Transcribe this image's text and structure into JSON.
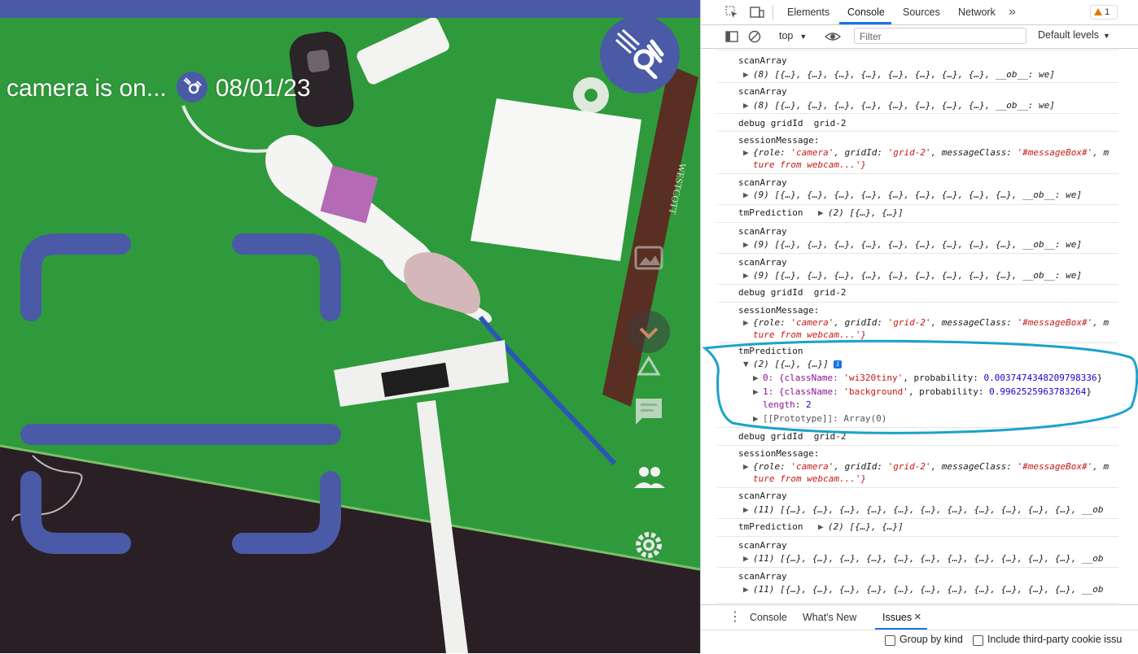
{
  "camera_app": {
    "status_text": "camera is on...",
    "date": "08/01/23",
    "ruler_brand": "WESTCOTT",
    "tag_qr": "Ⓠ"
  },
  "devtools": {
    "tabs": [
      "Elements",
      "Console",
      "Sources",
      "Network"
    ],
    "more_tabs": "»",
    "issues_count": "1",
    "context": "top",
    "filter_placeholder": "Filter",
    "levels": "Default levels",
    "drawer_tabs": {
      "console": "Console",
      "whats_new": "What's New",
      "issues": "Issues"
    },
    "checkbox_group_by_kind": "Group by kind",
    "checkbox_third_party": "Include third-party cookie issu",
    "close": "×"
  },
  "console": {
    "scan8_label": "scanArray",
    "scan8_value": "(8) [{…}, {…}, {…}, {…}, {…}, {…}, {…}, {…}, __ob__: we]",
    "debug_label": "debug gridId",
    "debug_value": "grid-2",
    "session_label": "sessionMessage:",
    "session_line1_a": "{role: ",
    "session_role": "'camera'",
    "session_line1_b": ", gridId: ",
    "session_grid": "'grid-2'",
    "session_line1_c": ", messageClass: ",
    "session_msgclass": "'#messageBox#'",
    "session_line1_d": ", m",
    "session_line2": "ture from webcam...'}",
    "scan9_value": "(9) [{…}, {…}, {…}, {…}, {…}, {…}, {…}, {…}, {…}, __ob__: we]",
    "tm_label": "tmPrediction",
    "tm_value": "(2) [{…}, {…}]",
    "tm_item0_a": "0: {className: ",
    "tm_item0_name": "'wi320tiny'",
    "tm_item0_b": ", probability: ",
    "tm_item0_prob": "0.0037474348209798336",
    "tm_item1_a": "1: {className: ",
    "tm_item1_name": "'background'",
    "tm_item1_b": ", probability: ",
    "tm_item1_prob": "0.9962525963783264",
    "tm_length_key": "length",
    "tm_length_val": "2",
    "tm_proto": "[[Prototype]]: Array(0)",
    "scan11_value": "(11) [{…}, {…}, {…}, {…}, {…}, {…}, {…}, {…}, {…}, {…}, {…}, __ob"
  },
  "colors": {
    "brand": "#4a5aa6",
    "annotation": "#1aa3c9",
    "green_mat": "#2f9a3b"
  }
}
